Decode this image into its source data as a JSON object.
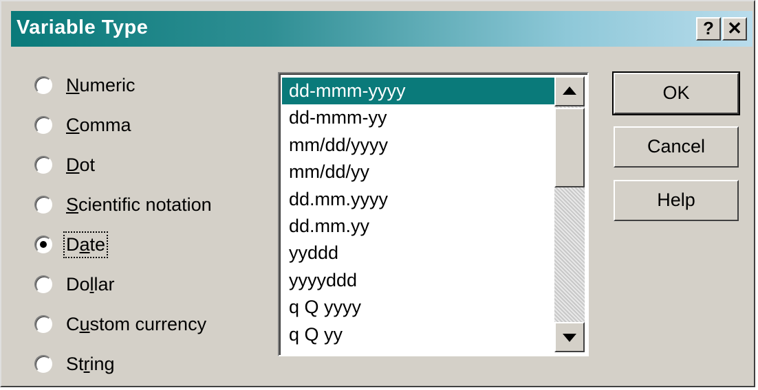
{
  "window": {
    "title": "Variable Type",
    "help_button": "?",
    "close_button": "✕"
  },
  "types": [
    {
      "pre": "",
      "accel": "N",
      "post": "umeric",
      "checked": false
    },
    {
      "pre": "",
      "accel": "C",
      "post": "omma",
      "checked": false
    },
    {
      "pre": "",
      "accel": "D",
      "post": "ot",
      "checked": false
    },
    {
      "pre": "",
      "accel": "S",
      "post": "cientific notation",
      "checked": false
    },
    {
      "pre": "D",
      "accel": "a",
      "post": "te",
      "checked": true
    },
    {
      "pre": "Do",
      "accel": "l",
      "post": "lar",
      "checked": false
    },
    {
      "pre": "C",
      "accel": "u",
      "post": "stom currency",
      "checked": false
    },
    {
      "pre": "St",
      "accel": "r",
      "post": "ing",
      "checked": false
    }
  ],
  "formats": {
    "items": [
      "dd-mmm-yyyy",
      "dd-mmm-yy",
      "mm/dd/yyyy",
      "mm/dd/yy",
      "dd.mm.yyyy",
      "dd.mm.yy",
      "yyddd",
      "yyyyddd",
      "q Q yyyy",
      "q Q yy"
    ],
    "selected": "dd-mmm-yyyy"
  },
  "buttons": {
    "ok": "OK",
    "cancel": "Cancel",
    "help": "Help"
  },
  "colors": {
    "selection": "#0a7a7a",
    "face": "#d4d0c8"
  }
}
